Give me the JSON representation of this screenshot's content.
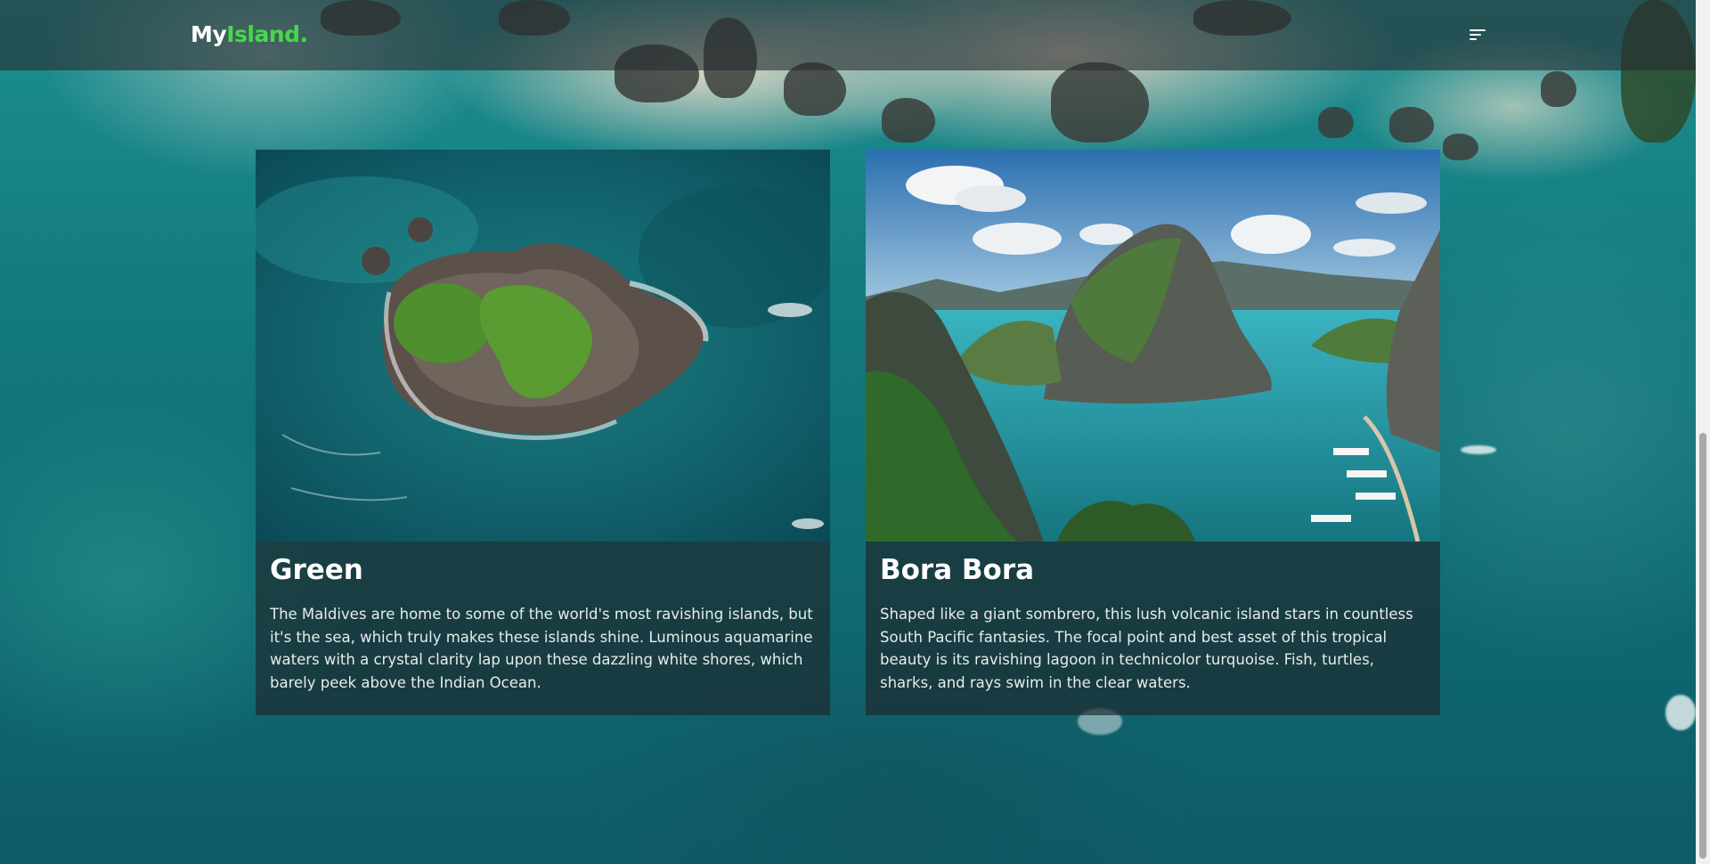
{
  "header": {
    "logo_part1": "My",
    "logo_part2": "Island.",
    "menu_icon": "hamburger-menu-icon"
  },
  "cards": [
    {
      "title": "Green",
      "description": "The Maldives are home to some of the world's most ravishing islands, but it's the sea, which truly makes these islands shine. Luminous aquamarine waters with a crystal clarity lap upon these dazzling white shores, which barely peek above the Indian Ocean."
    },
    {
      "title": "Bora Bora",
      "description": "Shaped like a giant sombrero, this lush volcanic island stars in countless South Pacific fantasies. The focal point and best asset of this tropical beauty is its ravishing lagoon in technicolor turquoise. Fish, turtles, sharks, and rays swim in the clear waters."
    }
  ],
  "colors": {
    "accent": "#45d84a",
    "header_bg": "rgba(40,45,48,0.62)",
    "card_bg": "rgba(30,40,44,0.68)"
  }
}
